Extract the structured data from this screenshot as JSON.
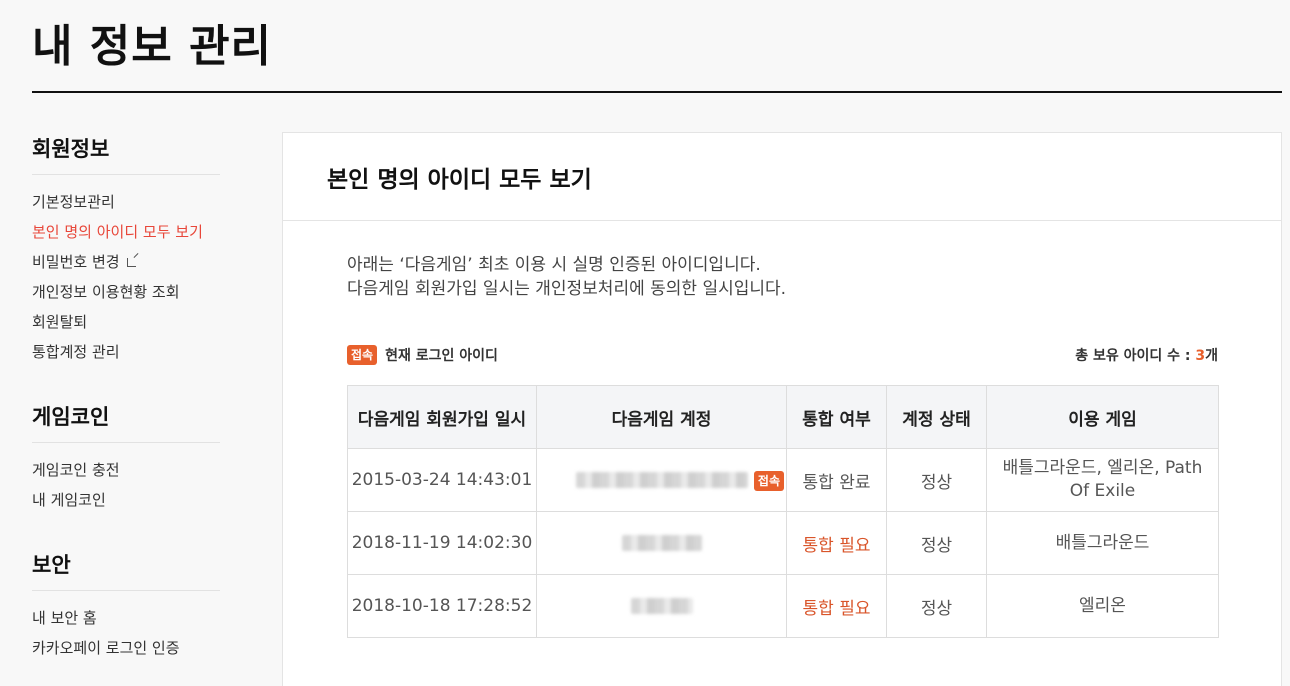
{
  "page": {
    "title": "내 정보 관리"
  },
  "sidebar": {
    "groups": [
      {
        "heading": "회원정보",
        "items": [
          "기본정보관리",
          "본인 명의 아이디 모두 보기",
          "비밀번호 변경",
          "개인정보 이용현황 조회",
          "회원탈퇴",
          "통합계정 관리"
        ]
      },
      {
        "heading": "게임코인",
        "items": [
          "게임코인 충전",
          "내 게임코인"
        ]
      },
      {
        "heading": "보안",
        "items": [
          "내 보안 홈",
          "카카오페이 로그인 인증"
        ]
      }
    ],
    "active_item": "본인 명의 아이디 모두 보기"
  },
  "panel": {
    "title": "본인 명의 아이디 모두 보기",
    "desc_line1": "아래는 ‘다음게임’ 최초 이용 시 실명 인증된 아이디입니다.",
    "desc_line2": "다음게임 회원가입 일시는 개인정보처리에 동의한 일시입니다.",
    "badge": "접속",
    "current_login_label": "현재 로그인 아이디",
    "total_label": "총 보유 아이디 수 : ",
    "total_count": "3",
    "total_unit": "개"
  },
  "table": {
    "headers": [
      "다음게임 회원가입 일시",
      "다음게임 계정",
      "통합 여부",
      "계정 상태",
      "이용 게임"
    ],
    "rows": [
      {
        "date": "2015-03-24 14:43:01",
        "account_badge": "접속",
        "merge": "통합 완료",
        "status": "정상",
        "games": "배틀그라운드, 엘리온, Path Of Exile"
      },
      {
        "date": "2018-11-19 14:02:30",
        "account_badge": "",
        "merge": "통합 필요",
        "status": "정상",
        "games": "배틀그라운드"
      },
      {
        "date": "2018-10-18 17:28:52",
        "account_badge": "",
        "merge": "통합 필요",
        "status": "정상",
        "games": "엘리온"
      }
    ]
  },
  "colors": {
    "accent": "#e8473a",
    "badge": "#e8602c",
    "need_merge": "#d9552a"
  },
  "icons": {
    "external_link": "external-link-icon"
  }
}
